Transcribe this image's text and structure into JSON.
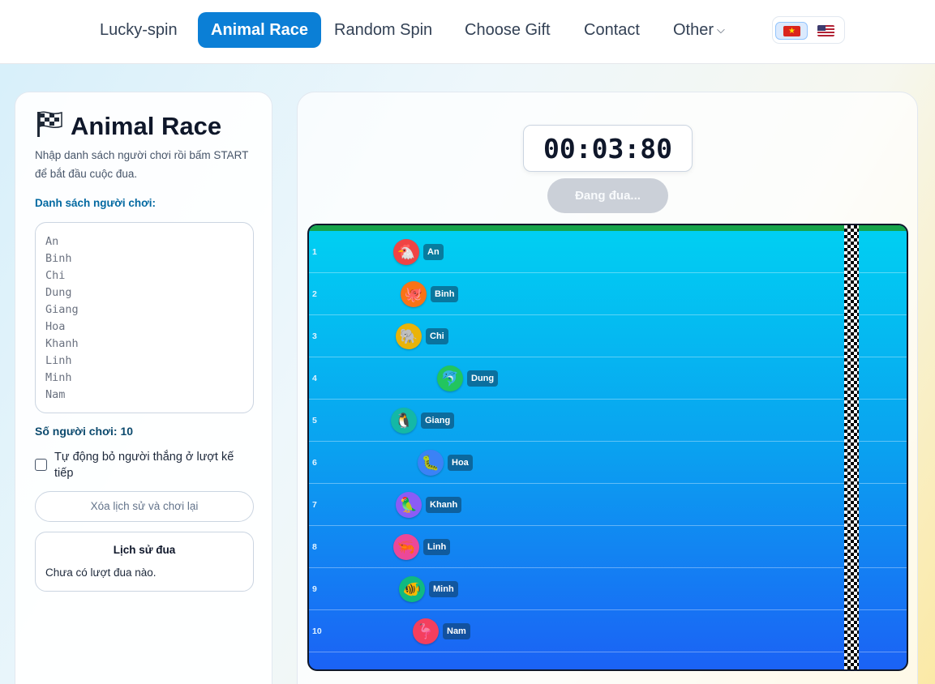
{
  "nav": {
    "items": [
      {
        "label": "Lucky-spin",
        "active": false
      },
      {
        "label": "Animal Race",
        "active": true
      },
      {
        "label": "Random Spin",
        "active": false
      },
      {
        "label": "Choose Gift",
        "active": false
      },
      {
        "label": "Contact",
        "active": false
      },
      {
        "label": "Other",
        "active": false,
        "dropdown": true
      }
    ],
    "languages": [
      {
        "code": "vi",
        "icon": "vietnam-flag-icon",
        "selected": true
      },
      {
        "code": "en",
        "icon": "us-flag-icon",
        "selected": false
      }
    ]
  },
  "left": {
    "title": "Animal Race",
    "title_icon": "checkered-flag-icon",
    "description": "Nhập danh sách người chơi rồi bấm START để bắt đầu cuộc đua.",
    "players_label": "Danh sách người chơi:",
    "players": [
      "An",
      "Binh",
      "Chi",
      "Dung",
      "Giang",
      "Hoa",
      "Khanh",
      "Linh",
      "Minh",
      "Nam"
    ],
    "count_label": "Số người chơi: 10",
    "auto_remove_label": "Tự động bỏ người thắng ở lượt kế tiếp",
    "auto_remove_checked": false,
    "reset_label": "Xóa lịch sử và chơi lại",
    "history_title": "Lịch sử đua",
    "history_empty": "Chưa có lượt đua nào."
  },
  "race": {
    "timer": "00:03:80",
    "status_label": "Đang đua...",
    "lanes": [
      {
        "no": "1",
        "name": "An",
        "animal": "🐔",
        "color": "#ef4444",
        "progress": 0.07
      },
      {
        "no": "2",
        "name": "Binh",
        "animal": "🐙",
        "color": "#f97316",
        "progress": 0.085
      },
      {
        "no": "3",
        "name": "Chi",
        "animal": "🐘",
        "color": "#eab308",
        "progress": 0.075
      },
      {
        "no": "4",
        "name": "Dung",
        "animal": "🐬",
        "color": "#22c55e",
        "progress": 0.16
      },
      {
        "no": "5",
        "name": "Giang",
        "animal": "🐧",
        "color": "#14b8a6",
        "progress": 0.065
      },
      {
        "no": "6",
        "name": "Hoa",
        "animal": "🐛",
        "color": "#3b82f6",
        "progress": 0.12
      },
      {
        "no": "7",
        "name": "Khanh",
        "animal": "🦜",
        "color": "#8b5cf6",
        "progress": 0.075
      },
      {
        "no": "8",
        "name": "Linh",
        "animal": "🦐",
        "color": "#ec4899",
        "progress": 0.07
      },
      {
        "no": "9",
        "name": "Minh",
        "animal": "🐠",
        "color": "#10b981",
        "progress": 0.082
      },
      {
        "no": "10",
        "name": "Nam",
        "animal": "🦩",
        "color": "#f43f5e",
        "progress": 0.11
      }
    ]
  }
}
